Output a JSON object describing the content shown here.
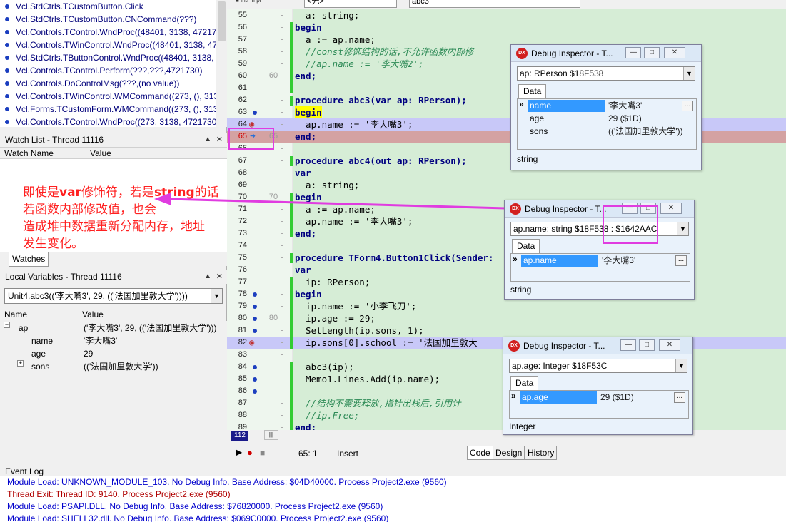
{
  "call_stack": {
    "items": [
      "Vcl.StdCtrls.TCustomButton.Click",
      "Vcl.StdCtrls.TCustomButton.CNCommand(???)",
      "Vcl.Controls.TControl.WndProc((48401, 3138, 4721730",
      "Vcl.Controls.TWinControl.WndProc((48401, 3138, 4721",
      "Vcl.StdCtrls.TButtonControl.WndProc((48401, 3138, 4",
      "Vcl.Controls.TControl.Perform(???,???,4721730)",
      "Vcl.Controls.DoControlMsg(???,(no value))",
      "Vcl.Controls.TWinControl.WMCommand((273, (), 3138,",
      "Vcl.Forms.TCustomForm.WMCommand((273, (), 3138,",
      "Vcl.Controls.TControl.WndProc((273, 3138, 4721730, 0"
    ]
  },
  "watch_list": {
    "title": "Watch List - Thread 11116",
    "col_name": "Watch Name",
    "col_value": "Value",
    "tab": "Watches"
  },
  "local_vars": {
    "title": "Local Variables - Thread 11116",
    "context": "Unit4.abc3(('李大嘴3', 29, (('法国加里敦大学'))))",
    "col_name": "Name",
    "col_value": "Value",
    "rows": [
      {
        "name": "ap",
        "value": "('李大嘴3', 29, (('法国加里敦大学')))",
        "expander": "−"
      },
      {
        "name": "name",
        "value": "'李大嘴3'",
        "expander": ""
      },
      {
        "name": "age",
        "value": "29",
        "expander": ""
      },
      {
        "name": "sons",
        "value": "(('法国加里敦大学'))",
        "expander": "+"
      }
    ]
  },
  "annotation": {
    "line1_a": "即使是",
    "line1_kw": "var",
    "line1_b": "修饰符，若是",
    "line1_kw2": "string",
    "line1_c": "的话",
    "line2": "若函数内部修改值，也会",
    "line3": "造成堆中数据重新分配内存，地址",
    "line4": "发生变化。"
  },
  "editor_toolbar": {
    "scope": "<无>",
    "method": "abc3"
  },
  "code_lines": [
    {
      "ln": "55",
      "ln2": "",
      "html": "  a: string;",
      "kind": ""
    },
    {
      "ln": "56",
      "ln2": "",
      "html": "begin",
      "kind": "kw"
    },
    {
      "ln": "57",
      "ln2": "",
      "html": "  a := ap.name;",
      "kind": ""
    },
    {
      "ln": "58",
      "ln2": "",
      "html": "  //const修饰结构的话,不允许函数内部修",
      "kind": "cmt"
    },
    {
      "ln": "59",
      "ln2": "",
      "html": "  //ap.name := '李大嘴2';",
      "kind": "cmt"
    },
    {
      "ln": "60",
      "ln2": "60",
      "html": "end;",
      "kind": "kw"
    },
    {
      "ln": "61",
      "ln2": "",
      "html": "",
      "kind": ""
    },
    {
      "ln": "62",
      "ln2": "",
      "html": "procedure abc3(var ap: RPerson);",
      "kind": "proc"
    },
    {
      "ln": "63",
      "ln2": "",
      "html": "begin",
      "kind": "beginy"
    },
    {
      "ln": "64",
      "ln2": "",
      "html": "  ap.name := '李大嘴3';",
      "kind": "blue"
    },
    {
      "ln": "65",
      "ln2": "65",
      "html": "end;",
      "kind": "red"
    },
    {
      "ln": "66",
      "ln2": "",
      "html": "",
      "kind": ""
    },
    {
      "ln": "67",
      "ln2": "",
      "html": "procedure abc4(out ap: RPerson);",
      "kind": "proc"
    },
    {
      "ln": "68",
      "ln2": "",
      "html": "var",
      "kind": "kw"
    },
    {
      "ln": "69",
      "ln2": "",
      "html": "  a: string;",
      "kind": ""
    },
    {
      "ln": "70",
      "ln2": "70",
      "html": "begin",
      "kind": "kw"
    },
    {
      "ln": "71",
      "ln2": "",
      "html": "  a := ap.name;",
      "kind": ""
    },
    {
      "ln": "72",
      "ln2": "",
      "html": "  ap.name := '李大嘴3';",
      "kind": ""
    },
    {
      "ln": "73",
      "ln2": "",
      "html": "end;",
      "kind": "kw"
    },
    {
      "ln": "74",
      "ln2": "",
      "html": "",
      "kind": ""
    },
    {
      "ln": "75",
      "ln2": "",
      "html": "procedure TForm4.Button1Click(Sender:",
      "kind": "proc"
    },
    {
      "ln": "76",
      "ln2": "",
      "html": "var",
      "kind": "kw"
    },
    {
      "ln": "77",
      "ln2": "",
      "html": "  ip: RPerson;",
      "kind": ""
    },
    {
      "ln": "78",
      "ln2": "",
      "html": "begin",
      "kind": "kw"
    },
    {
      "ln": "79",
      "ln2": "",
      "html": "  ip.name := '小李飞刀';",
      "kind": ""
    },
    {
      "ln": "80",
      "ln2": "80",
      "html": "  ip.age := 29;",
      "kind": ""
    },
    {
      "ln": "81",
      "ln2": "",
      "html": "  SetLength(ip.sons, 1);",
      "kind": ""
    },
    {
      "ln": "82",
      "ln2": "",
      "html": "  ip.sons[0].school := '法国加里敦大",
      "kind": "blue"
    },
    {
      "ln": "83",
      "ln2": "",
      "html": "",
      "kind": ""
    },
    {
      "ln": "84",
      "ln2": "",
      "html": "  abc3(ip);",
      "kind": ""
    },
    {
      "ln": "85",
      "ln2": "",
      "html": "  Memo1.Lines.Add(ip.name);",
      "kind": ""
    },
    {
      "ln": "86",
      "ln2": "",
      "html": "",
      "kind": ""
    },
    {
      "ln": "87",
      "ln2": "",
      "html": "  //结构不需要释放,指针出栈后,引用计",
      "kind": "cmt"
    },
    {
      "ln": "88",
      "ln2": "",
      "html": "  //ip.Free;",
      "kind": "cmt"
    },
    {
      "ln": "89",
      "ln2": "",
      "html": "end;",
      "kind": "kw"
    }
  ],
  "status": {
    "position": "65:  1",
    "mode": "Insert",
    "tabs": [
      "Code",
      "Design",
      "History"
    ],
    "line_marker": "112"
  },
  "event_log": {
    "title": "Event Log",
    "rows": [
      {
        "text": "Module Load: UNKNOWN_MODULE_103. No Debug Info. Base Address: $04D40000. Process Project2.exe (9560)",
        "color": "#0000cc"
      },
      {
        "text": "Thread Exit: Thread ID: 9140. Process Project2.exe (9560)",
        "color": "#b00000"
      },
      {
        "text": "Module Load: PSAPI.DLL. No Debug Info. Base Address: $76820000. Process Project2.exe (9560)",
        "color": "#0000cc"
      },
      {
        "text": "Module Load: SHELL32.dll. No Debug Info. Base Address: $069C0000. Process Project2.exe (9560)",
        "color": "#0000cc"
      }
    ]
  },
  "inspector1": {
    "title": "Debug Inspector - T...",
    "combo": "ap: RPerson $18F538",
    "tab": "Data",
    "rows": [
      {
        "name": "name",
        "value": "'李大嘴3'"
      },
      {
        "name": "age",
        "value": "29 ($1D)"
      },
      {
        "name": "sons",
        "value": "(('法国加里敦大学'))"
      }
    ],
    "footer": "string"
  },
  "inspector2": {
    "title": "Debug Inspector - T...",
    "combo": "ap.name: string $18F538 : $1642AAC",
    "tab": "Data",
    "rows": [
      {
        "name": "ap.name",
        "value": "'李大嘴3'"
      }
    ],
    "footer": "string"
  },
  "inspector3": {
    "title": "Debug Inspector - T...",
    "combo": "ap.age: Integer $18F53C",
    "tab": "Data",
    "rows": [
      {
        "name": "ap.age",
        "value": "29 ($1D)"
      }
    ],
    "footer": "Integer"
  },
  "colors": {
    "annotation": "#ff2020",
    "arrow": "#e03ce0",
    "editor_bg": "#d6edd6"
  }
}
